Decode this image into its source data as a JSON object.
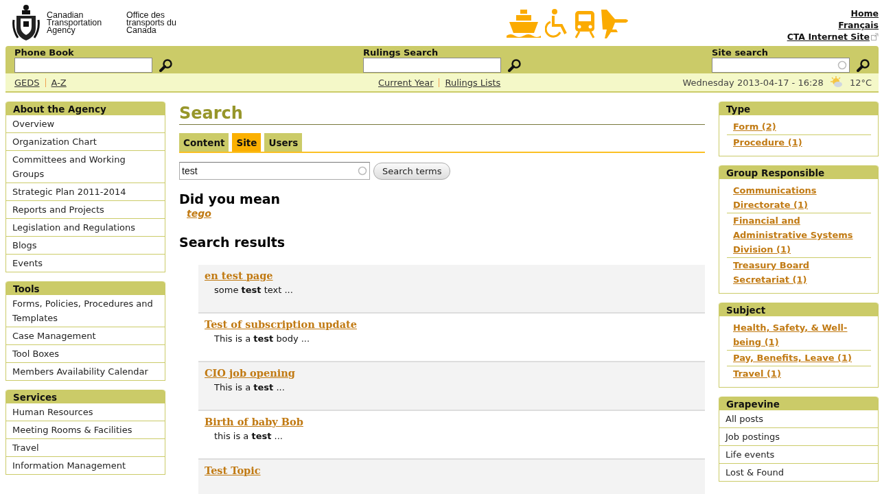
{
  "header": {
    "agency_en": "Canadian Transportation Agency",
    "agency_fr": "Office des transports du Canada",
    "links": [
      {
        "label": "Home",
        "kind": "internal"
      },
      {
        "label": "Français",
        "kind": "internal"
      },
      {
        "label": "CTA Internet Site",
        "kind": "external"
      }
    ]
  },
  "search_bar": [
    {
      "label": "Phone Book",
      "kind": "plain"
    },
    {
      "label": "Rulings Search",
      "kind": "plain"
    },
    {
      "label": "Site search",
      "kind": "spinner"
    }
  ],
  "sub_nav": {
    "left": [
      "GEDS",
      "A-Z"
    ],
    "center": [
      "Current Year",
      "Rulings Lists"
    ],
    "datetime": "Wednesday 2013-04-17 - 16:28",
    "temperature": "12°C"
  },
  "left_nav": [
    {
      "title": "About the Agency",
      "items": [
        "Overview",
        "Organization Chart",
        "Committees and Working Groups",
        "Strategic Plan 2011-2014",
        "Reports and Projects",
        "Legislation and Regulations",
        "Blogs",
        "Events"
      ]
    },
    {
      "title": "Tools",
      "items": [
        "Forms, Policies, Procedures and Templates",
        "Case Management",
        "Tool Boxes",
        "Members Availability Calendar"
      ]
    },
    {
      "title": "Services",
      "items": [
        "Human Resources",
        "Meeting Rooms & Facilities",
        "Travel",
        "Information Management"
      ]
    }
  ],
  "main": {
    "title": "Search",
    "tabs": [
      {
        "label": "Content",
        "selected": false
      },
      {
        "label": "Site",
        "selected": true
      },
      {
        "label": "Users",
        "selected": false
      }
    ],
    "query": "test",
    "search_button": "Search terms",
    "did_you_mean": "Did you mean",
    "suggestion": "tego",
    "results_heading": "Search results",
    "results": [
      {
        "title": "en test page",
        "snippet": "some **test** text ..."
      },
      {
        "title": "Test of subscription update",
        "snippet": "This is a **test** body ..."
      },
      {
        "title": "CIO job opening",
        "snippet": "This is a **test** ..."
      },
      {
        "title": "Birth of baby Bob",
        "snippet": "this is a **test** ..."
      },
      {
        "title": "Test Topic"
      }
    ]
  },
  "right_nav": [
    {
      "title": "Type",
      "kind": "facets",
      "items": [
        "Form (2)",
        "Procedure (1)"
      ]
    },
    {
      "title": "Group Responsible",
      "kind": "facets",
      "items": [
        "Communications Directorate (1)",
        "Financial and Administrative Systems Division (1)",
        "Treasury Board Secretariat (1)"
      ]
    },
    {
      "title": "Subject",
      "kind": "facets",
      "items": [
        "Health, Safety, & Well-being (1)",
        "Pay, Benefits, Leave (1)",
        "Travel (1)"
      ]
    },
    {
      "title": "Grapevine",
      "kind": "menu",
      "items": [
        "All posts",
        "Job postings",
        "Life events",
        "Lost & Found"
      ]
    }
  ]
}
